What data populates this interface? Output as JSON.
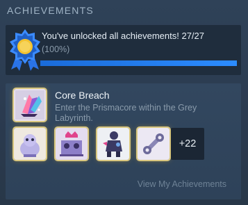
{
  "header": {
    "title": "ACHIEVEMENTS"
  },
  "summary": {
    "unlock_text": "You've unlocked all achievements! 27/27",
    "percent_text": "(100%)",
    "progress_fraction": 1.0
  },
  "featured": {
    "title": "Core Breach",
    "description": "Enter the Prismacore within the Grey Labyrinth.",
    "icon": "prismacore-crystal-icon"
  },
  "recent_icons": [
    "blob-creature-icon",
    "crowned-figures-icon",
    "dark-hero-icon",
    "wrench-tool-icon"
  ],
  "more_count": "+22",
  "footer": {
    "view_link": "View My Achievements"
  },
  "colors": {
    "accent_blue": "#1a6bd9",
    "badge_gold": "#f2c230",
    "icon_border": "#d9c77f"
  }
}
